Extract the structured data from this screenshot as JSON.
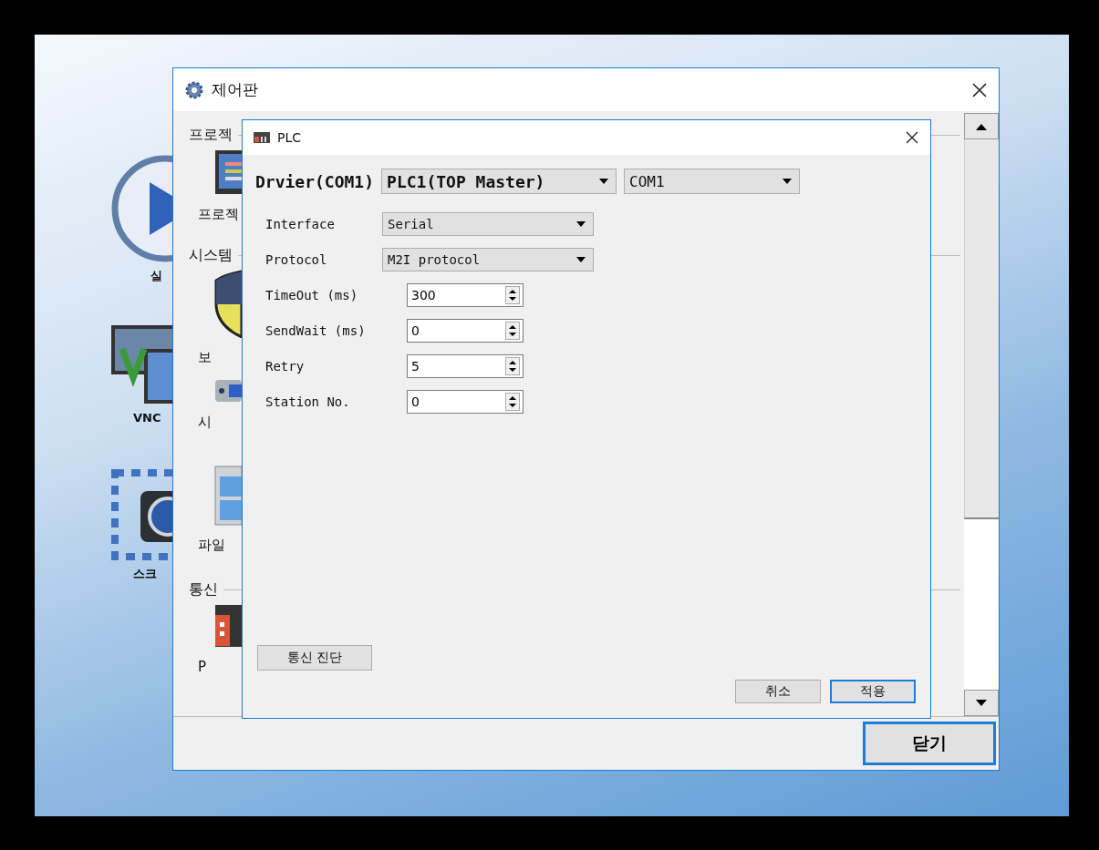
{
  "desktop": {
    "icons": [
      {
        "kind": "play",
        "label": "실"
      },
      {
        "kind": "vnc",
        "label": "VNC"
      },
      {
        "kind": "camera",
        "label": "스크"
      }
    ]
  },
  "control_panel": {
    "title": "제어판",
    "sections": [
      {
        "heading": "프로젝",
        "items": [
          {
            "kind": "screen",
            "label": "프로젝"
          }
        ]
      },
      {
        "heading": "시스템",
        "items": [
          {
            "kind": "shield",
            "label": "보"
          },
          {
            "kind": "device",
            "label": "시"
          },
          {
            "kind": "cabinet",
            "label": "파일"
          }
        ]
      },
      {
        "heading": "통신",
        "items": [
          {
            "kind": "plc",
            "label": "P"
          }
        ]
      }
    ],
    "close_button": "닫기"
  },
  "plc_dialog": {
    "title": "PLC",
    "driver_label": "Drvier(COM1)",
    "driver_select": "PLC1(TOP Master)",
    "port_select": "COM1",
    "settings": [
      {
        "kind": "select",
        "label": "Interface",
        "value": "Serial"
      },
      {
        "kind": "select",
        "label": "Protocol",
        "value": "M2I protocol"
      },
      {
        "kind": "spin",
        "label": "TimeOut (ms)",
        "value": "300"
      },
      {
        "kind": "spin",
        "label": "SendWait (ms)",
        "value": "0"
      },
      {
        "kind": "spin",
        "label": "Retry",
        "value": "5"
      },
      {
        "kind": "spin",
        "label": "Station No.",
        "value": "0"
      }
    ],
    "diagnose_button": "통신 진단",
    "cancel_button": "취소",
    "apply_button": "적용"
  }
}
